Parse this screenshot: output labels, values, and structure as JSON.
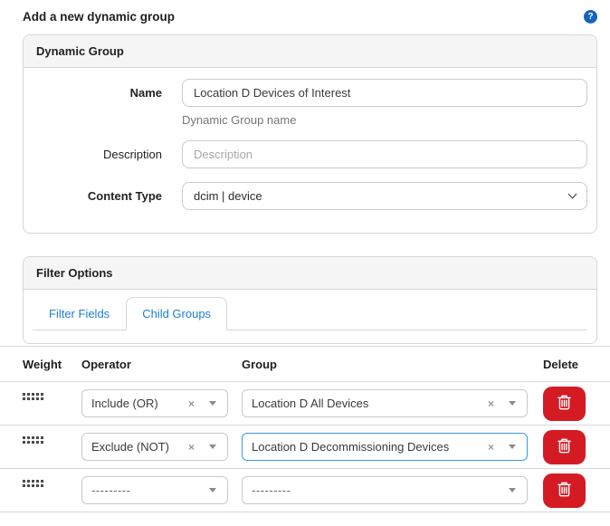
{
  "page": {
    "title": "Add a new dynamic group",
    "help_icon_glyph": "?"
  },
  "dynamic_group_panel": {
    "title": "Dynamic Group",
    "name_field": {
      "label": "Name",
      "value": "Location D Devices of Interest",
      "help_text": "Dynamic Group name"
    },
    "description_field": {
      "label": "Description",
      "value": "",
      "placeholder": "Description"
    },
    "content_type_field": {
      "label": "Content Type",
      "value": "dcim | device"
    }
  },
  "filter_options_panel": {
    "title": "Filter Options",
    "tabs": [
      {
        "label": "Filter Fields",
        "active": false
      },
      {
        "label": "Child Groups",
        "active": true
      }
    ]
  },
  "child_groups": {
    "columns": [
      "Weight",
      "Operator",
      "Group",
      "Delete"
    ],
    "rows": [
      {
        "operator": "Include (OR)",
        "group": "Location D All Devices",
        "clearable": true,
        "group_focused": false
      },
      {
        "operator": "Exclude (NOT)",
        "group": "Location D Decommissioning Devices",
        "clearable": true,
        "group_focused": true
      },
      {
        "operator": "---------",
        "group": "---------",
        "clearable": false,
        "group_focused": false
      }
    ]
  },
  "icons": {
    "clear": "×"
  },
  "colors": {
    "link_blue": "#1c7ed6",
    "focus_blue": "#3b99e0",
    "danger_red": "#d41b24",
    "help_blue": "#1565c0",
    "panel_header_bg": "#f5f5f5",
    "border_gray": "#d6d6d6"
  }
}
